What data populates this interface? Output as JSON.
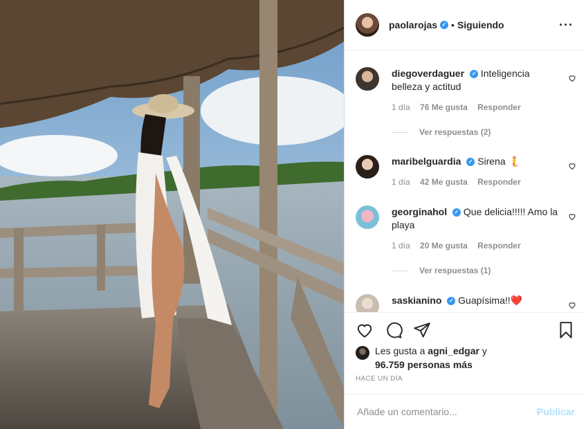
{
  "post": {
    "author": "paolarojas",
    "follow_status": "Siguiendo",
    "more_icon": "ellipsis-icon",
    "photo_description_icon": "post-photo"
  },
  "comments": [
    {
      "user": "diegoverdaguer",
      "verified": true,
      "text": "Inteligencia belleza y actitud",
      "age": "1 día",
      "likes": "76 Me gusta",
      "reply": "Responder",
      "replies": "Ver respuestas (2)"
    },
    {
      "user": "maribelguardia",
      "verified": true,
      "text": "Sirena 🧜",
      "age": "1 día",
      "likes": "42 Me gusta",
      "reply": "Responder"
    },
    {
      "user": "georginahol",
      "verified": true,
      "text": "Que delicia!!!!! Amo la playa",
      "age": "1 día",
      "likes": "20 Me gusta",
      "reply": "Responder",
      "replies": "Ver respuestas (1)"
    },
    {
      "user": "saskianino",
      "verified": true,
      "text": "Guapísima!!❤️"
    }
  ],
  "likes": {
    "prefix": "Les gusta a",
    "user": "agni_edgar",
    "connector": "y",
    "count": "96.759 personas más"
  },
  "timestamp": "HACE UN DÍA",
  "add_comment": {
    "placeholder": "Añade un comentario...",
    "publish_label": "Publicar"
  },
  "colors": {
    "verified": "#3897f0",
    "publish_disabled": "#b2dffc",
    "muted_text": "#8e8e8e"
  }
}
